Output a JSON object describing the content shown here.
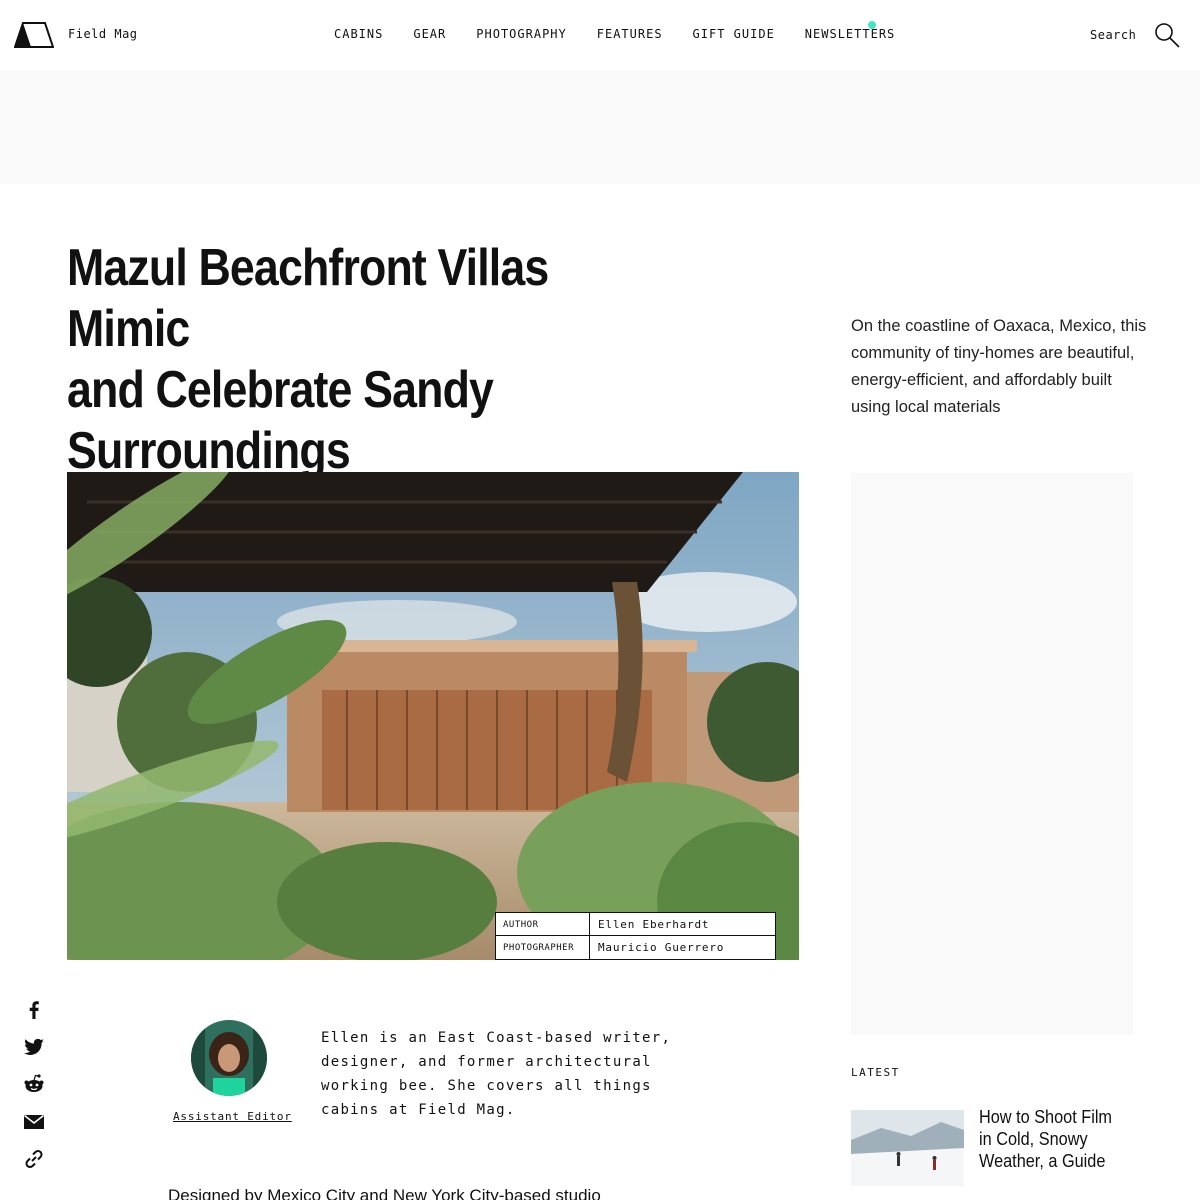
{
  "header": {
    "brand": "Field Mag",
    "nav": [
      "CABINS",
      "GEAR",
      "PHOTOGRAPHY",
      "FEATURES",
      "GIFT GUIDE",
      "NEWSLETTERS"
    ],
    "search_label": "Search",
    "accent_color": "#3ee7c2"
  },
  "article": {
    "title_lines": [
      "Mazul Beachfront Villas Mimic",
      "and Celebrate Sandy",
      "Surroundings"
    ],
    "dek": "On the coastline of Oaxaca, Mexico, this community of tiny-homes are beautiful, energy-efficient, and affordably built using local materials",
    "credits": [
      {
        "label": "AUTHOR",
        "value": "Ellen Eberhardt"
      },
      {
        "label": "PHOTOGRAPHER",
        "value": "Mauricio Guerrero"
      }
    ],
    "author_role": "Assistant Editor",
    "author_bio": "Ellen is an East Coast-based writer, designer, and former architectural working bee. She covers all things cabins at Field Mag.",
    "body_start": "Designed by Mexico City and New York City-based studio"
  },
  "social": [
    "facebook-icon",
    "twitter-icon",
    "reddit-icon",
    "email-icon",
    "link-icon"
  ],
  "latest": {
    "label": "LATEST",
    "items": [
      {
        "title": "How to Shoot Film in Cold, Snowy Weather, a Guide"
      }
    ]
  }
}
